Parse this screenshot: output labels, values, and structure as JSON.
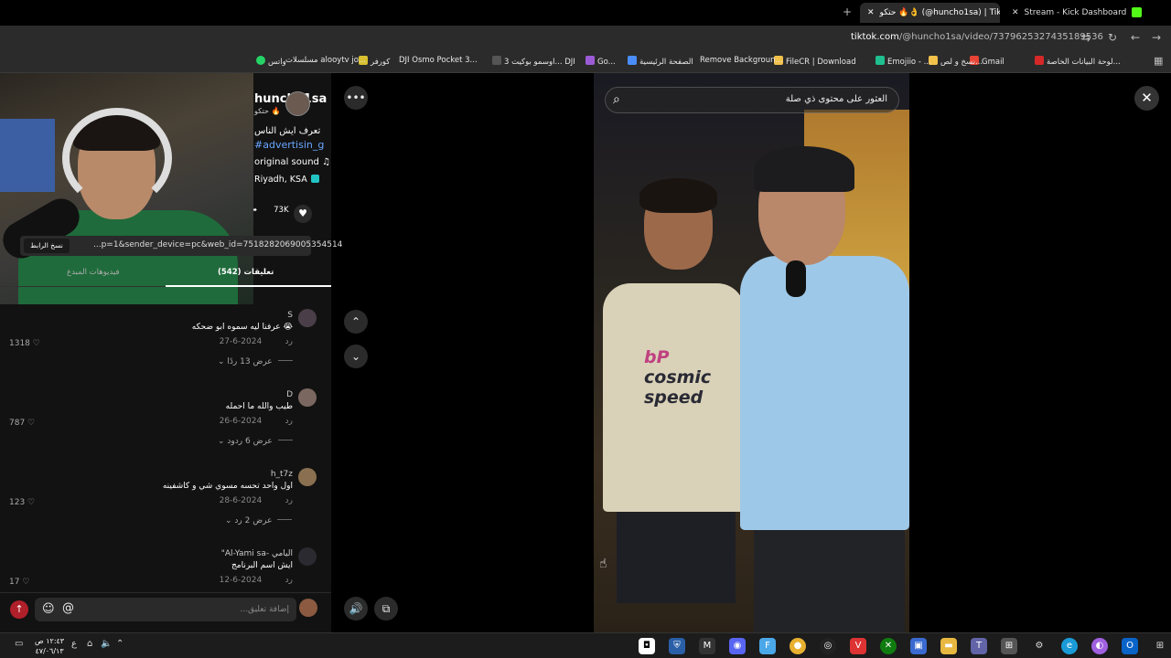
{
  "browser": {
    "tabs": [
      {
        "label": "Stream - Kick Dashboard",
        "active": false
      },
      {
        "label": "حتكو 🔥👌 (@huncho1sa) | TikTok",
        "active": true
      }
    ],
    "url_domain": "tiktok.com",
    "url_path": "/@huncho1sa/video/7379625327435189536",
    "bookmarks": [
      {
        "label": "لوحة البيانات الخاصة...",
        "color": "#d62828"
      },
      {
        "label": "Gmail",
        "color": "#e94335"
      },
      {
        "label": "نسخ و لص...",
        "color": "#f2c14a"
      },
      {
        "label": "Emojiio - ...",
        "color": "#1fbf8f"
      },
      {
        "label": "FileCR | Download",
        "color": "#f2c14a"
      },
      {
        "label": "Remove Backgroun...",
        "color": "#8a6de9"
      },
      {
        "label": "الصفحة الرئيسية",
        "color": "#4b8df8"
      },
      {
        "label": "Go...",
        "color": "#9c5bd6"
      },
      {
        "label": "اوسمو بوكيت 3... DJI",
        "color": "#555555"
      },
      {
        "label": "DJI Osmo Pocket 3...",
        "color": "#777777"
      },
      {
        "label": "كورفر",
        "color": "#d8c030"
      },
      {
        "label": "مسلسلات alooytv jo...",
        "color": "#d8c030"
      },
      {
        "label": "واتس",
        "color": "#25d366"
      }
    ]
  },
  "post": {
    "author_name": "huncho1sa",
    "author_sub": "حتكو 🔥",
    "description_line1": "تعرف ايش الناس",
    "hashtag": "#advertisin_g",
    "sound": "original sound",
    "location": "Riyadh, KSA",
    "likes": "73K",
    "copy_link_label": "نسخ الرابط",
    "link_text": "...p=1&sender_device=pc&web_id=7518282069005354514"
  },
  "tabs": {
    "comments": "تعليقات (542)",
    "creator_videos": "فيديوهات المبدع"
  },
  "comments": [
    {
      "user": "S",
      "text": "عرفنا ليه سموه ابو ضحكه 😭",
      "date": "2024-6-27",
      "reply": "رد",
      "likes": "1318",
      "replies": "عرض 13 ردًا"
    },
    {
      "user": "D",
      "text": "طيب والله ما احمله",
      "date": "2024-6-26",
      "reply": "رد",
      "likes": "787",
      "replies": "عرض 6 ردود"
    },
    {
      "user": "h_t7z",
      "text": "اول واحد تحسه مسوي شي و كاشفينه",
      "date": "2024-6-28",
      "reply": "رد",
      "likes": "123",
      "replies": "عرض 2 رد"
    },
    {
      "user": "\"Al-Yami sa- اليامي",
      "text": "ايش اسم البرنامج",
      "date": "2024-6-12",
      "reply": "رد",
      "likes": "17",
      "replies": ""
    }
  ],
  "comment_input": {
    "placeholder": "إضافة تعليق..."
  },
  "video": {
    "search_text": "العثور على محتوى ذي صلة",
    "shirt_print": [
      "bP",
      "cosmic",
      "speed"
    ]
  },
  "taskbar": {
    "time": "١٢:٤٣ ص",
    "date": "٤٧/٠٦/١٣",
    "lang": "ع"
  },
  "colors": {
    "accent_red": "#b0202a",
    "hashtag_blue": "#68a6ff",
    "tiktok_bg": "#121212"
  }
}
